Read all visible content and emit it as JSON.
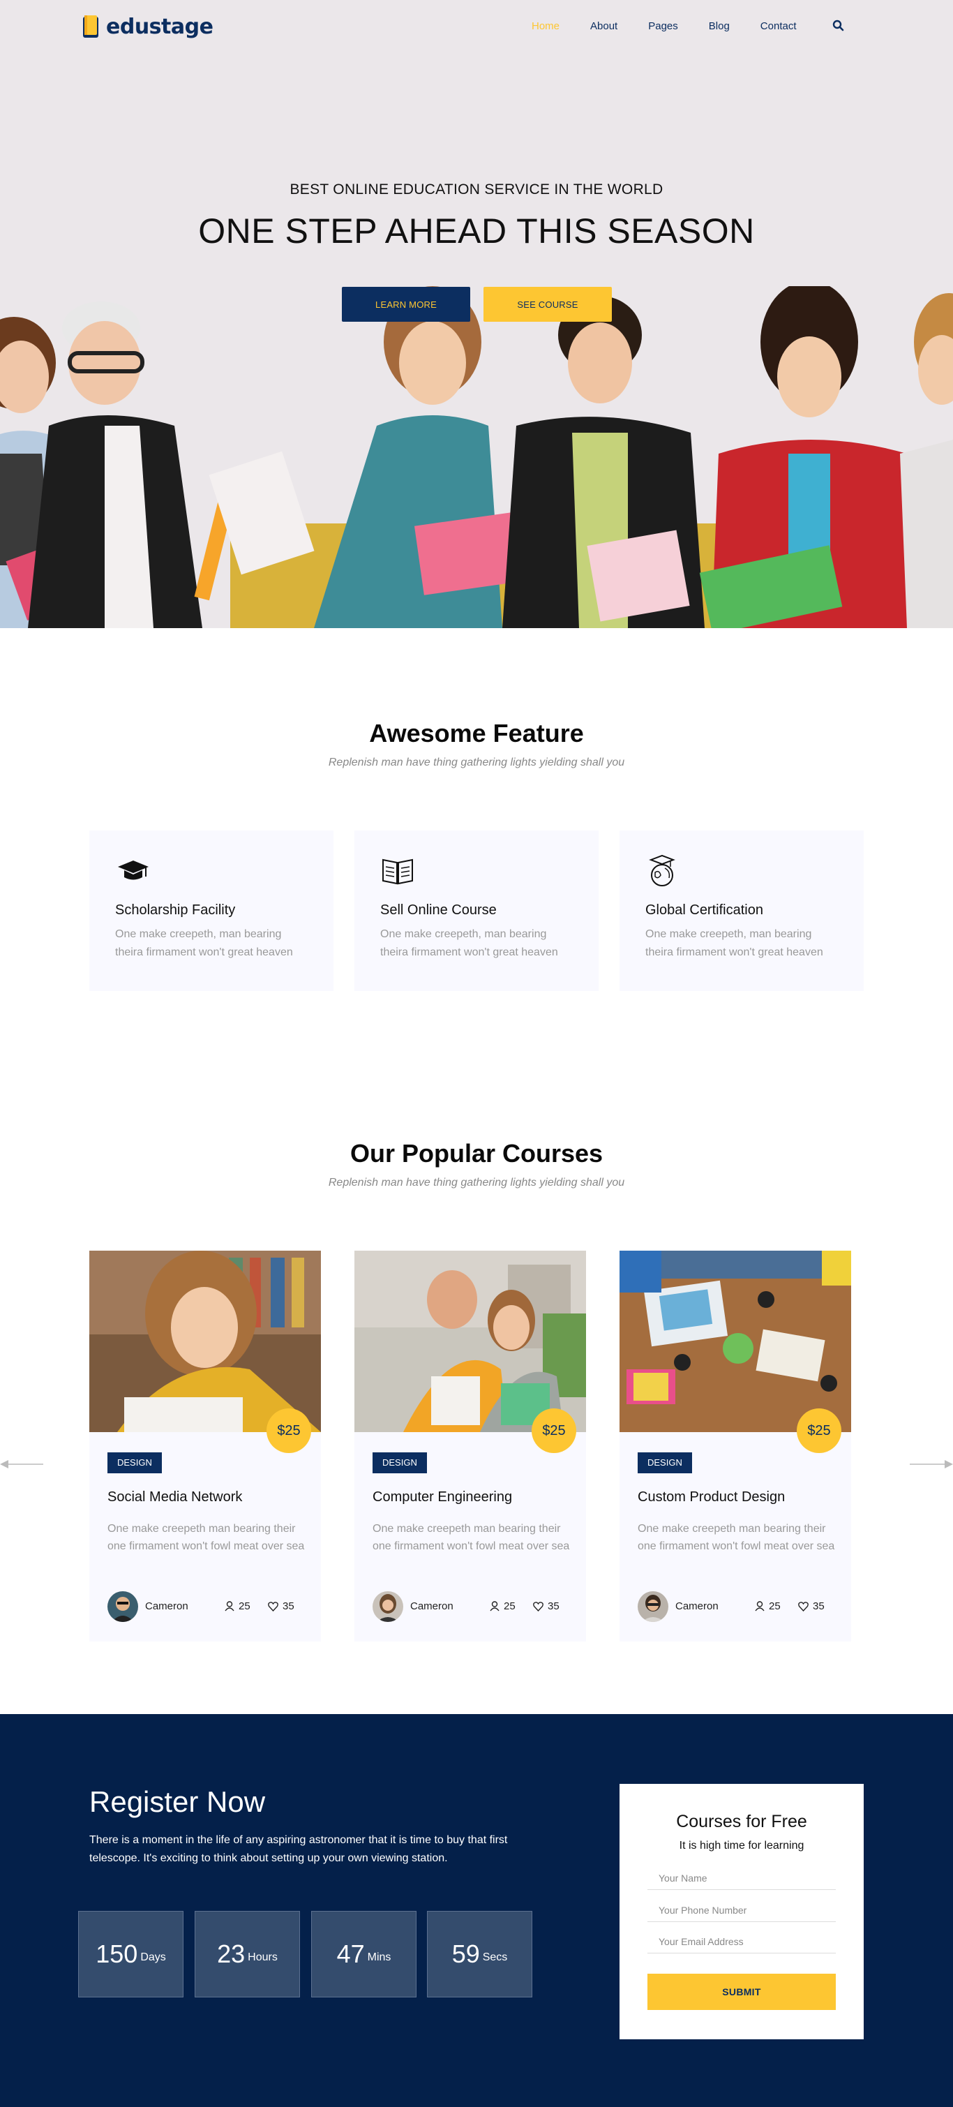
{
  "brand": {
    "name": "edustage",
    "accent": "#fdc632",
    "navy": "#0c2e60"
  },
  "nav": {
    "items": [
      {
        "label": "Home",
        "active": true
      },
      {
        "label": "About"
      },
      {
        "label": "Pages"
      },
      {
        "label": "Blog"
      },
      {
        "label": "Contact"
      }
    ],
    "search_icon": "search-icon"
  },
  "hero": {
    "subtitle": "BEST ONLINE EDUCATION SERVICE IN THE WORLD",
    "title": "ONE STEP AHEAD THIS SEASON",
    "primary_button": "LEARN MORE",
    "secondary_button": "SEE COURSE"
  },
  "features": {
    "title": "Awesome Feature",
    "subtitle": "Replenish man have thing gathering lights yielding shall you",
    "items": [
      {
        "icon": "graduation-cap-icon",
        "title": "Scholarship Facility",
        "text": "One make creepeth, man bearing theira firmament won't great heaven"
      },
      {
        "icon": "open-book-icon",
        "title": "Sell Online Course",
        "text": "One make creepeth, man bearing theira firmament won't great heaven"
      },
      {
        "icon": "graduate-globe-icon",
        "title": "Global Certification",
        "text": "One make creepeth, man bearing theira firmament won't great heaven"
      }
    ]
  },
  "courses": {
    "title": "Our Popular Courses",
    "subtitle": "Replenish man have thing gathering lights yielding shall you",
    "items": [
      {
        "price": "$25",
        "tag": "DESIGN",
        "title": "Social Media Network",
        "text": "One make creepeth man bearing their one firmament won't fowl meat over sea",
        "author": "Cameron",
        "students": "25",
        "likes": "35"
      },
      {
        "price": "$25",
        "tag": "DESIGN",
        "title": "Computer Engineering",
        "text": "One make creepeth man bearing their one firmament won't fowl meat over sea",
        "author": "Cameron",
        "students": "25",
        "likes": "35"
      },
      {
        "price": "$25",
        "tag": "DESIGN",
        "title": "Custom Product Design",
        "text": "One make creepeth man bearing their one firmament won't fowl meat over sea",
        "author": "Cameron",
        "students": "25",
        "likes": "35"
      }
    ]
  },
  "register": {
    "title": "Register Now",
    "text": "There is a moment in the life of any aspiring astronomer that it is time to buy that first telescope. It's exciting to think about setting up your own viewing station.",
    "countdown": [
      {
        "value": "150",
        "unit": "Days"
      },
      {
        "value": "23",
        "unit": "Hours"
      },
      {
        "value": "47",
        "unit": "Mins"
      },
      {
        "value": "59",
        "unit": "Secs"
      }
    ],
    "form": {
      "title": "Courses for Free",
      "subtitle": "It is high time for learning",
      "name_placeholder": "Your Name",
      "phone_placeholder": "Your Phone Number",
      "email_placeholder": "Your Email Address",
      "submit": "SUBMIT"
    }
  }
}
